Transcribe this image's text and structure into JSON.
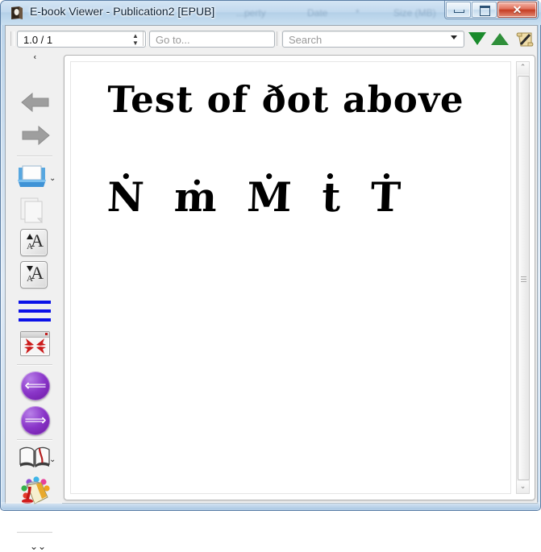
{
  "window": {
    "title": "E-book Viewer - Publication2 [EPUB]",
    "app_icon": "book-icon",
    "ghost_text": [
      "...perty",
      "Date",
      "*",
      "Size (MB)"
    ],
    "controls": {
      "minimize": "minimize-button",
      "maximize": "maximize-button",
      "close_label": "✕"
    }
  },
  "toolbar": {
    "page_position": "1.0 / 1",
    "goto_placeholder": "Go to...",
    "search_placeholder": "Search",
    "search_value": "",
    "find_next_label": "find-next",
    "find_previous_label": "find-previous",
    "reference_mode_label": "reference-mode"
  },
  "sidebar": {
    "items": [
      {
        "name": "back",
        "label": "Back",
        "state": "disabled"
      },
      {
        "name": "forward",
        "label": "Forward",
        "state": "disabled"
      },
      {
        "name": "open-ebook",
        "label": "Open ebook",
        "has_dropdown": true
      },
      {
        "name": "copy",
        "label": "Copy",
        "state": "disabled"
      },
      {
        "name": "increase-font-size",
        "label": "Increase font size",
        "big": "A",
        "small": "A"
      },
      {
        "name": "decrease-font-size",
        "label": "Decrease font size",
        "big": "A",
        "small": "A"
      },
      {
        "name": "table-of-contents",
        "label": "Table of Contents",
        "color": "#0b12e8"
      },
      {
        "name": "fullscreen",
        "label": "Toggle full screen"
      },
      {
        "name": "previous-section",
        "label": "Previous section"
      },
      {
        "name": "next-section",
        "label": "Next section"
      },
      {
        "name": "bookmarks",
        "label": "Bookmarks",
        "has_dropdown": true
      },
      {
        "name": "preferences",
        "label": "Preferences"
      }
    ],
    "overflow_label": "»"
  },
  "document": {
    "heading": "Test of ðot above",
    "characters": "Ṅ ṁ Ṁ ṫ Ṫ"
  },
  "scrollbar": {
    "up_label": "⌃",
    "down_label": "⌄",
    "thumb_position": "top"
  },
  "colors": {
    "accent_blue": "#0b12e8",
    "purple_button": "#8a36c9",
    "green_find": "#1a8a2c",
    "close_red": "#c53c22",
    "titlebar": "#b4d0e8"
  }
}
